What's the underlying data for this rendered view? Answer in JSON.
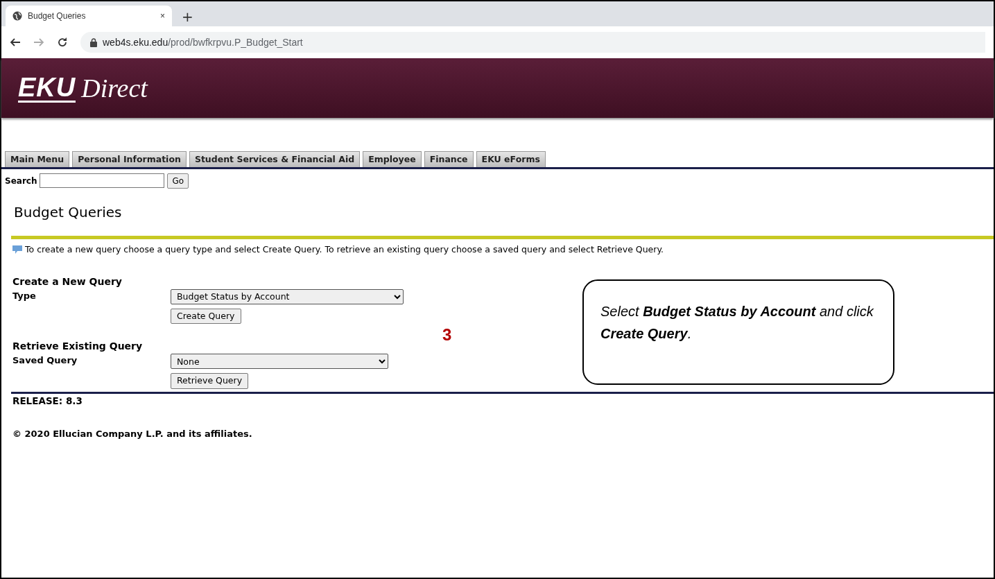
{
  "browser": {
    "tab_title": "Budget Queries",
    "tab_close": "×",
    "new_tab": "+",
    "url_host": "web4s.eku.edu",
    "url_path": "/prod/bwfkrpvu.P_Budget_Start"
  },
  "banner": {
    "logo_main": "EKU",
    "logo_sub": "Direct"
  },
  "nav_tabs": [
    {
      "label": "Main Menu"
    },
    {
      "label": "Personal Information"
    },
    {
      "label": "Student Services & Financial Aid"
    },
    {
      "label": "Employee"
    },
    {
      "label": "Finance"
    },
    {
      "label": "EKU eForms"
    }
  ],
  "search": {
    "label": "Search",
    "button": "Go"
  },
  "page_title": "Budget Queries",
  "info_text": "To create a new query choose a query type and select Create Query. To retrieve an existing query choose a saved query and select Retrieve Query.",
  "sections": [
    {
      "heading": "Create a New Query",
      "field_label": "Type",
      "value": "Budget Status by Account",
      "button": "Create Query"
    },
    {
      "heading": "Retrieve Existing Query",
      "field_label": "Saved Query",
      "value": "None",
      "button": "Retrieve Query"
    }
  ],
  "step_number": "3",
  "callout": "Select **Budget Status by Account** and click **Create Query**.",
  "release": "RELEASE: 8.3",
  "copyright": "© 2020 Ellucian Company L.P. and its affiliates."
}
